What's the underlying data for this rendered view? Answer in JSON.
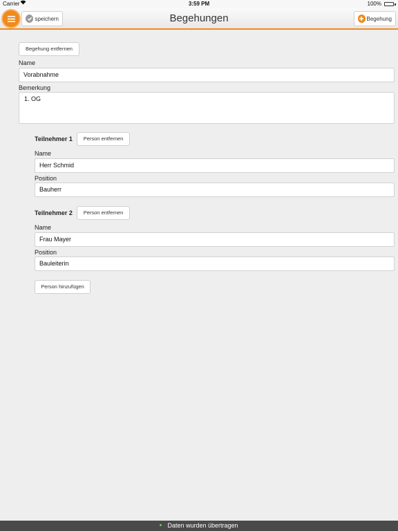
{
  "status_bar": {
    "carrier": "Carrier",
    "time": "3:59 PM",
    "battery_percent": "100%",
    "battery_level": 1.0,
    "battery_color": "#38c24a"
  },
  "navbar": {
    "title": "Begehungen",
    "save_label": "speichern",
    "add_label": "Begehung",
    "accent_color": "#f08a1c"
  },
  "form": {
    "remove_inspection_label": "Begehung entfernen",
    "name_label": "Name",
    "name_value": "Vorabnahme",
    "remark_label": "Bemerkung",
    "remark_value": "1. OG",
    "participants": [
      {
        "title": "Teilnehmer 1",
        "remove_label": "Person entfernen",
        "name_label": "Name",
        "name_value": "Herr Schmid",
        "position_label": "Position",
        "position_value": "Bauherr"
      },
      {
        "title": "Teilnehmer 2",
        "remove_label": "Person entfernen",
        "name_label": "Name",
        "name_value": "Frau Mayer",
        "position_label": "Position",
        "position_value": "Bauleiterin"
      }
    ],
    "add_person_label": "Person hinzufügen"
  },
  "toast": {
    "message": "Daten wurden übertragen"
  }
}
